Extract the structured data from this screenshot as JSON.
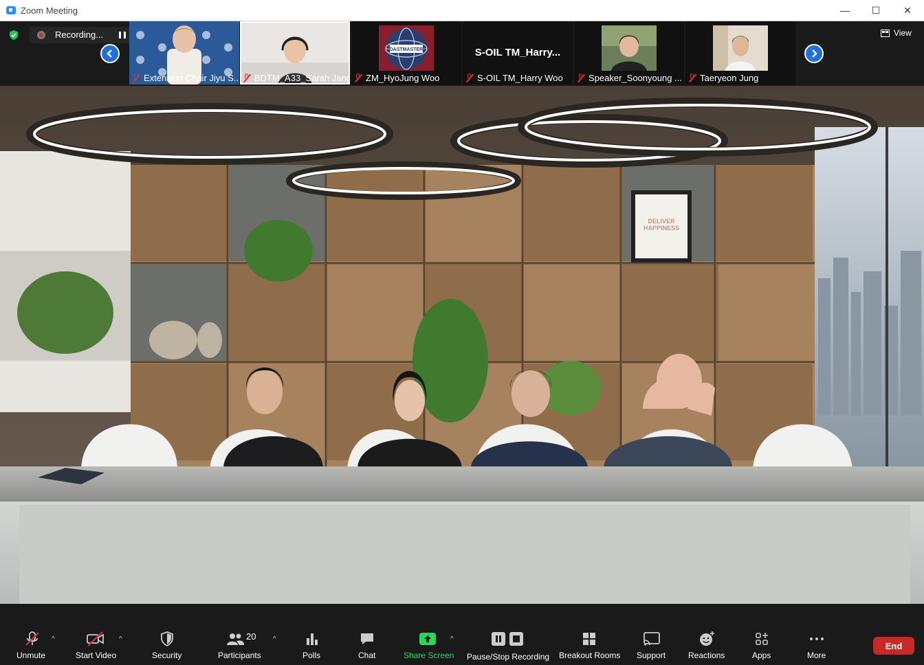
{
  "window": {
    "title": "Zoom Meeting",
    "minimize": "—",
    "maximize": "☐",
    "close": "✕"
  },
  "recording": {
    "label": "Recording..."
  },
  "view": {
    "label": "View"
  },
  "thumbnails": [
    {
      "name": "Extension Chair Jiyu S..."
    },
    {
      "name": "BDTM_A33_Sarah Jang"
    },
    {
      "name": "ZM_HyoJung Woo"
    },
    {
      "name": "S-OIL TM_Harry Woo",
      "display_text": "S-OIL  TM_Harry..."
    },
    {
      "name": "Speaker_Soonyoung ..."
    },
    {
      "name": "Taeryeon Jung"
    }
  ],
  "stage": {
    "poster_text": "DELIVER HAPPINESS"
  },
  "toolbar": {
    "unmute": "Unmute",
    "start_video": "Start Video",
    "security": "Security",
    "participants": "Participants",
    "participant_count": "20",
    "polls": "Polls",
    "chat": "Chat",
    "share_screen": "Share Screen",
    "pause_stop_recording": "Pause/Stop Recording",
    "breakout_rooms": "Breakout Rooms",
    "support": "Support",
    "reactions": "Reactions",
    "apps": "Apps",
    "more": "More",
    "end": "End"
  },
  "colors": {
    "accent": "#2d8cff",
    "share_green": "#23d959",
    "end_red": "#c92828",
    "muted_red": "#e03030"
  }
}
